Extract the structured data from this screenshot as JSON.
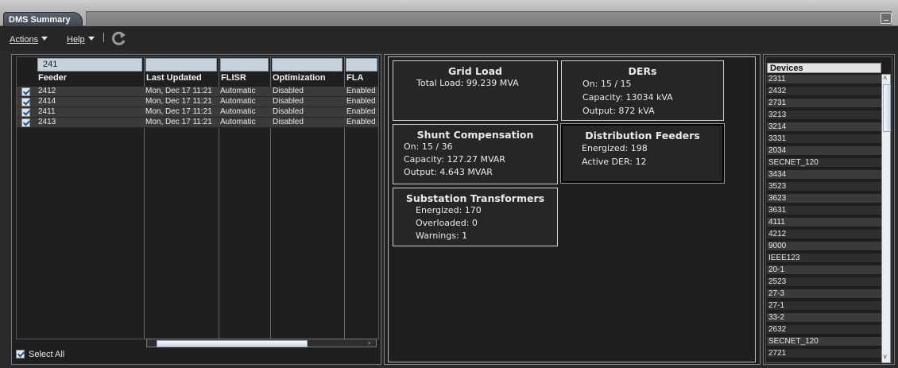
{
  "window": {
    "tab_title": "DMS Summary"
  },
  "menu": {
    "actions": "Actions",
    "help": "Help"
  },
  "feeder_table": {
    "filter_value": "241",
    "columns": [
      "Feeder",
      "Last Updated",
      "FLISR",
      "Optimization",
      "FLA"
    ],
    "rows": [
      {
        "feeder": "2412",
        "updated": "Mon, Dec 17 11:21",
        "flisr": "Automatic",
        "optimization": "Disabled",
        "fla": "Enabled",
        "checked": true
      },
      {
        "feeder": "2414",
        "updated": "Mon, Dec 17 11:21",
        "flisr": "Automatic",
        "optimization": "Disabled",
        "fla": "Enabled",
        "checked": true
      },
      {
        "feeder": "2411",
        "updated": "Mon, Dec 17 11:21",
        "flisr": "Automatic",
        "optimization": "Disabled",
        "fla": "Enabled",
        "checked": true
      },
      {
        "feeder": "2413",
        "updated": "Mon, Dec 17 11:21",
        "flisr": "Automatic",
        "optimization": "Disabled",
        "fla": "Enabled",
        "checked": true
      }
    ],
    "select_all_label": "Select All",
    "select_all_checked": true
  },
  "summary": {
    "grid_load": {
      "title": "Grid Load",
      "lines": [
        "Total Load: 99.239 MVA"
      ]
    },
    "ders": {
      "title": "DERs",
      "lines": [
        "On: 15 / 15",
        "Capacity: 13034 kVA",
        "Output: 872 kVA"
      ]
    },
    "shunt": {
      "title": "Shunt Compensation",
      "lines": [
        "On: 15 / 36",
        "Capacity: 127.27 MVAR",
        "Output: 4.643 MVAR"
      ]
    },
    "feeders": {
      "title": "Distribution Feeders",
      "lines": [
        "Energized: 198",
        "Active DER: 12"
      ]
    },
    "transformers": {
      "title": "Substation Transformers",
      "lines": [
        "Energized: 170",
        "Overloaded: 0",
        "Warnings: 1"
      ]
    }
  },
  "devices": {
    "header": "Devices",
    "items": [
      "2311",
      "2432",
      "2731",
      "3213",
      "3214",
      "3331",
      "2034",
      "SECNET_120",
      "3434",
      "3523",
      "3623",
      "3631",
      "4111",
      "4212",
      "9000",
      "IEEE123",
      "20-1",
      "2523",
      "27-3",
      "27-1",
      "33-2",
      "2632",
      "SECNET_120",
      "2721"
    ]
  }
}
